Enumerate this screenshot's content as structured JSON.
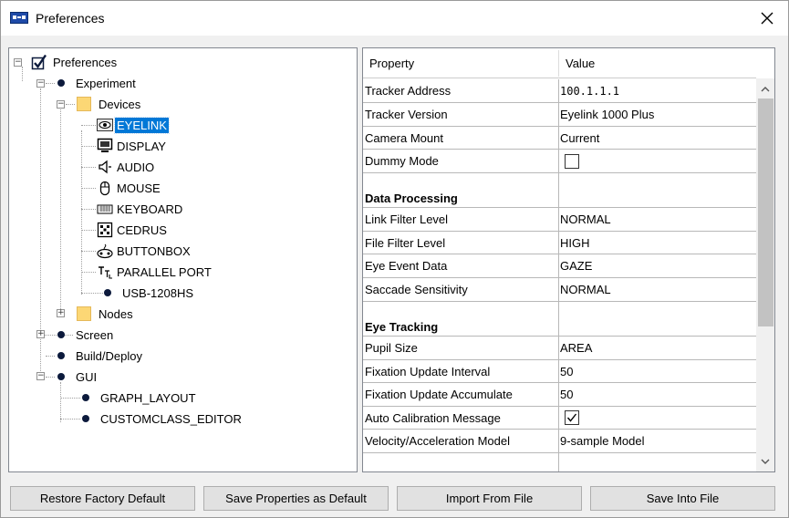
{
  "window": {
    "title": "Preferences"
  },
  "tree": {
    "root": "Preferences",
    "experiment": "Experiment",
    "devices": "Devices",
    "device_items": [
      "EYELINK",
      "DISPLAY",
      "AUDIO",
      "MOUSE",
      "KEYBOARD",
      "CEDRUS",
      "BUTTONBOX",
      "PARALLEL PORT",
      "USB-1208HS"
    ],
    "nodes": "Nodes",
    "screen": "Screen",
    "build_deploy": "Build/Deploy",
    "gui": "GUI",
    "gui_items": [
      "GRAPH_LAYOUT",
      "CUSTOMCLASS_EDITOR"
    ],
    "selected": "EYELINK"
  },
  "grid": {
    "headers": {
      "property": "Property",
      "value": "Value"
    },
    "rows": [
      {
        "key": "Tracker Address",
        "value": "100.1.1.1"
      },
      {
        "key": "Tracker Version",
        "value": "Eyelink 1000 Plus"
      },
      {
        "key": "Camera Mount",
        "value": "Current"
      },
      {
        "key": "Dummy Mode",
        "value": "",
        "checked": false
      },
      {
        "key": "Data Processing",
        "section": true
      },
      {
        "key": "Link Filter Level",
        "value": "NORMAL"
      },
      {
        "key": "File Filter Level",
        "value": "HIGH"
      },
      {
        "key": "Eye Event Data",
        "value": "GAZE"
      },
      {
        "key": "Saccade Sensitivity",
        "value": "NORMAL"
      },
      {
        "key": "Eye Tracking",
        "section": true
      },
      {
        "key": "Pupil Size",
        "value": "AREA"
      },
      {
        "key": "Fixation Update Interval",
        "value": "50"
      },
      {
        "key": "Fixation Update Accumulate",
        "value": "50"
      },
      {
        "key": "Auto Calibration Message",
        "value": "",
        "checked": true
      },
      {
        "key": "Velocity/Acceleration Model",
        "value": "9-sample Model"
      }
    ]
  },
  "buttons": {
    "restore": "Restore Factory Default",
    "save_default": "Save Properties as Default",
    "import": "Import From File",
    "save_file": "Save Into File"
  },
  "colors": {
    "selection": "#0078d7",
    "button_bg": "#e1e1e1"
  }
}
